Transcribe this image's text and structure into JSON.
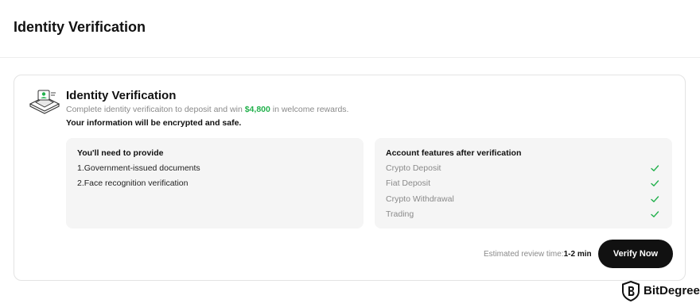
{
  "header": {
    "title": "Identity Verification"
  },
  "card": {
    "icon": "id-card-illustration-icon",
    "title": "Identity Verification",
    "description_before": "Complete identity verificaiton to deposit and win ",
    "reward_amount": "$4,800",
    "description_after": " in welcome rewards.",
    "secure_note": "Your information will be encrypted and safe.",
    "requirements": {
      "heading": "You'll need to provide",
      "items": [
        "1.Government-issued documents",
        "2.Face recognition verification"
      ]
    },
    "features": {
      "heading": "Account features after verification",
      "items": [
        "Crypto Deposit",
        "Fiat Deposit",
        "Crypto Withdrawal",
        "Trading"
      ],
      "check_icon": "check-icon",
      "check_color": "#22b14c"
    },
    "review_label": "Estimated review time:",
    "review_time": "1-2 min",
    "verify_button": "Verify Now"
  },
  "watermark": {
    "logo": "bitdegree-shield-icon",
    "text": "BitDegree"
  }
}
